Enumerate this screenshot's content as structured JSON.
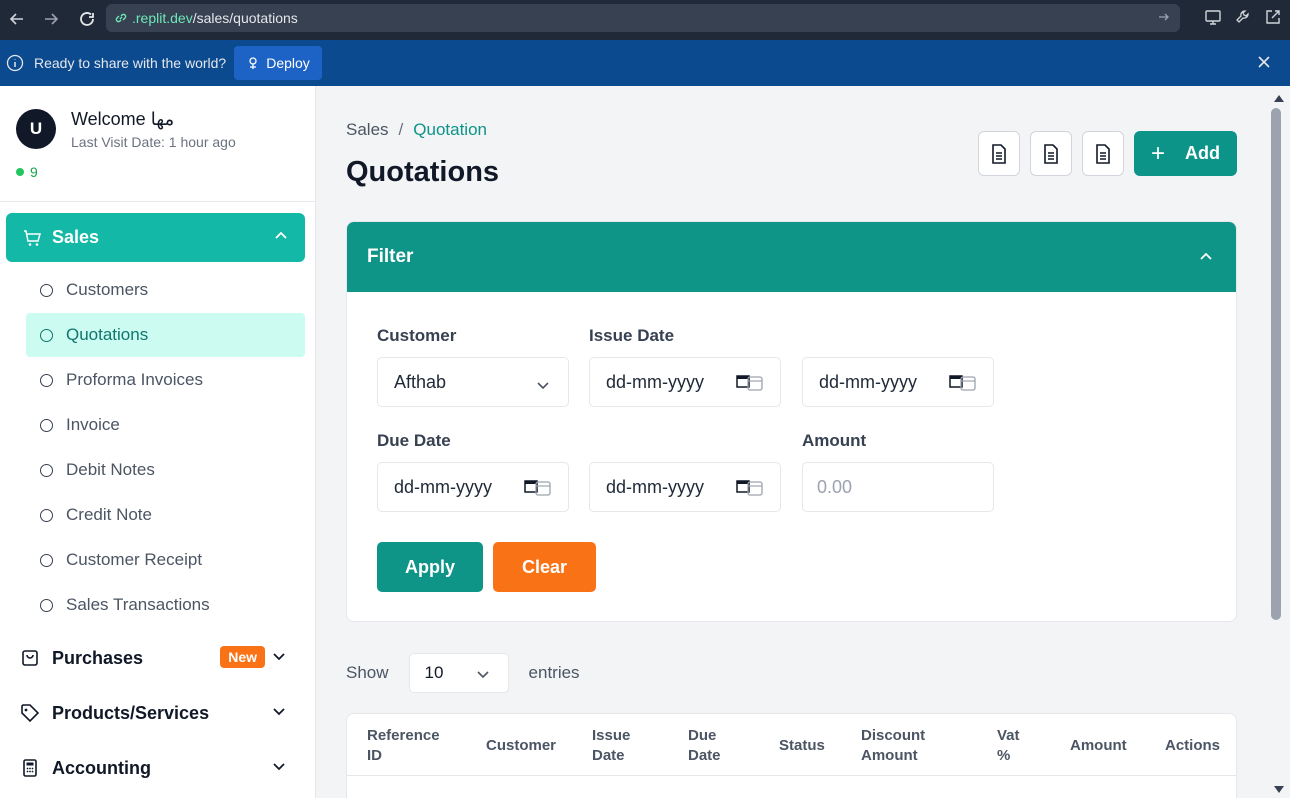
{
  "browser": {
    "url_domain": ".replit.dev",
    "url_path": "/sales/quotations"
  },
  "deploy_bar": {
    "message": "Ready to share with the world?",
    "button_label": "Deploy"
  },
  "profile": {
    "avatar_initial": "U",
    "welcome": "Welcome مها",
    "last_visit": "Last Visit Date: 1 hour ago",
    "status_count": "9"
  },
  "sidebar": {
    "sales_label": "Sales",
    "sales_items": [
      {
        "label": "Customers"
      },
      {
        "label": "Quotations"
      },
      {
        "label": "Proforma Invoices"
      },
      {
        "label": "Invoice"
      },
      {
        "label": "Debit Notes"
      },
      {
        "label": "Credit Note"
      },
      {
        "label": "Customer Receipt"
      },
      {
        "label": "Sales Transactions"
      }
    ],
    "purchases_label": "Purchases",
    "purchases_badge": "New",
    "products_label": "Products/Services",
    "accounting_label": "Accounting"
  },
  "main": {
    "breadcrumb_root": "Sales",
    "breadcrumb_sep": "/",
    "breadcrumb_current": "Quotation",
    "title": "Quotations",
    "add_label": "Add",
    "add_plus": "+"
  },
  "filter": {
    "title": "Filter",
    "customer_label": "Customer",
    "customer_value": "Afthab",
    "issue_date_label": "Issue Date",
    "issue_from": "dd-mm-yyyy",
    "issue_to": "dd-mm-yyyy",
    "due_date_label": "Due Date",
    "due_from": "dd-mm-yyyy",
    "due_to": "dd-mm-yyyy",
    "amount_label": "Amount",
    "amount_placeholder": "0.00",
    "apply_label": "Apply",
    "clear_label": "Clear"
  },
  "entries": {
    "show": "Show",
    "value": "10",
    "entries": "entries"
  },
  "table": {
    "headers": [
      "Reference ID",
      "Customer",
      "Issue Date",
      "Due Date",
      "Status",
      "Discount Amount",
      "Vat %",
      "Amount",
      "Actions"
    ]
  },
  "colors": {
    "accent": "#0f9488",
    "sales_active": "#14b8a6",
    "clear": "#f97316"
  }
}
